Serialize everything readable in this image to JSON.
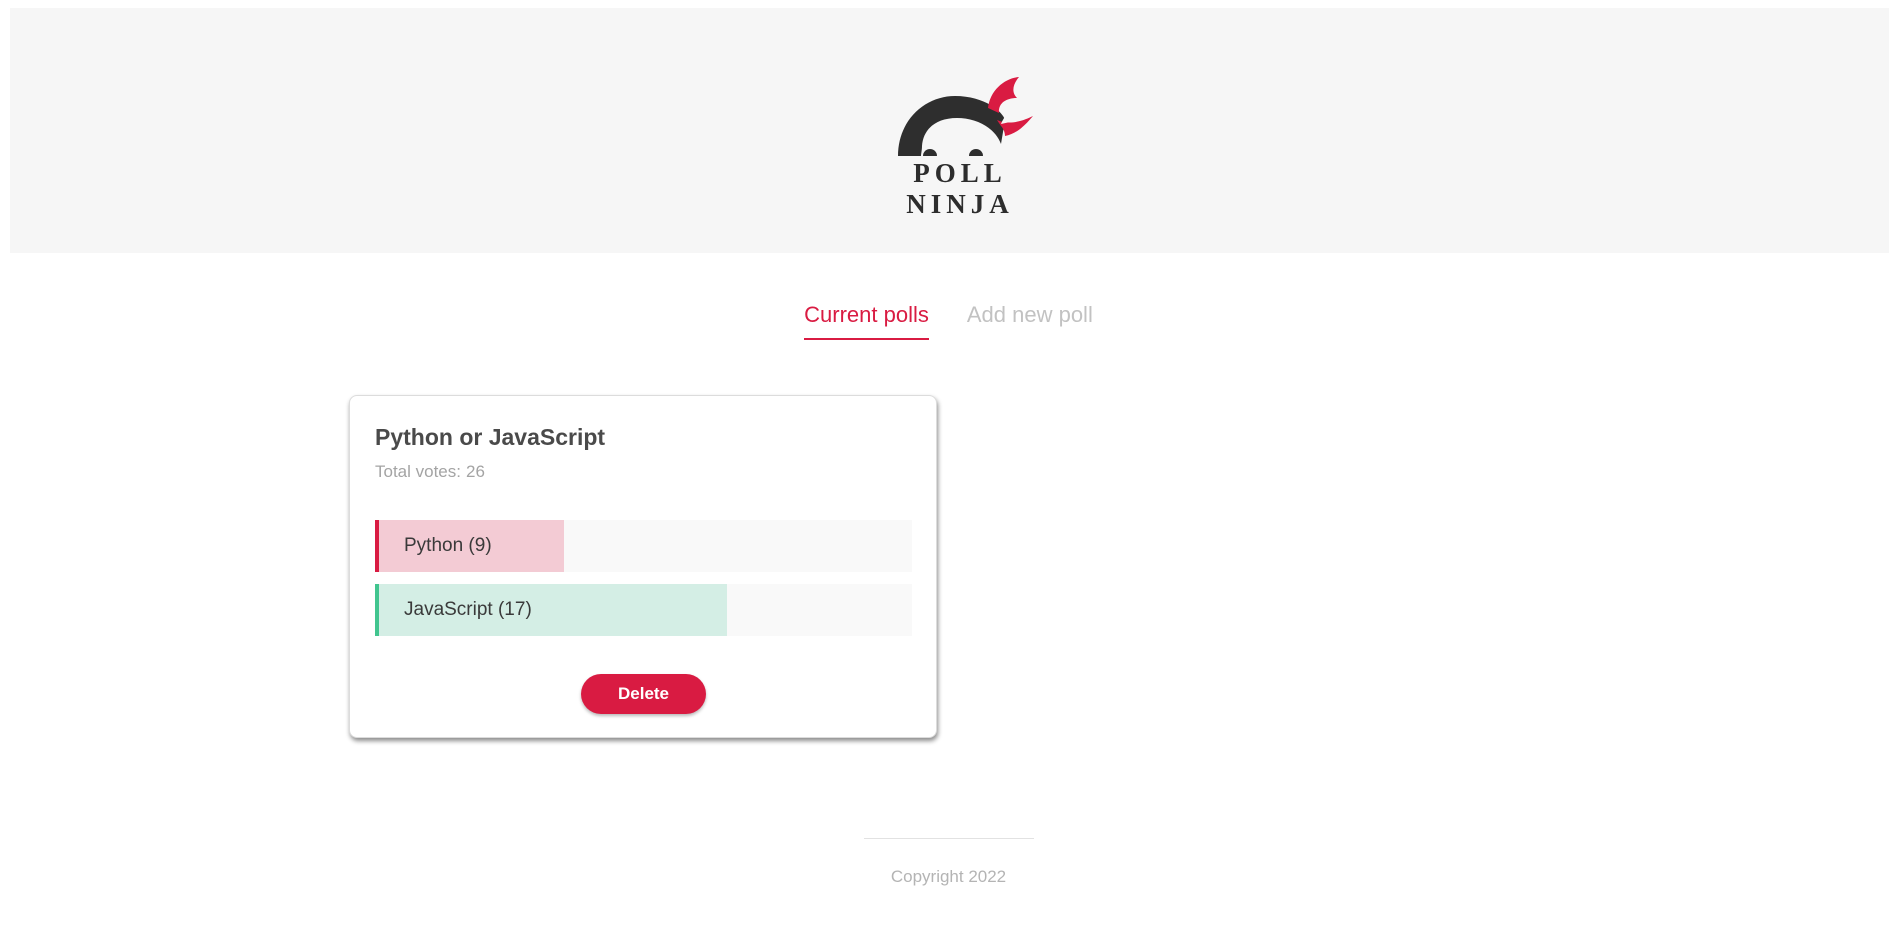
{
  "header": {
    "logo_text": "POLL NINJA"
  },
  "tabs": [
    {
      "label": "Current polls",
      "active": true
    },
    {
      "label": "Add new poll",
      "active": false
    }
  ],
  "polls": [
    {
      "question": "Python or JavaScript",
      "total_label": "Total votes:",
      "total_votes": 26,
      "options": [
        {
          "label": "Python (9)",
          "votes": 9,
          "color": "#d91b42",
          "fill": "#f3cbd4"
        },
        {
          "label": "JavaScript (17)",
          "votes": 17,
          "color": "#41c58f",
          "fill": "#d4eee5"
        }
      ],
      "delete_label": "Delete"
    }
  ],
  "footer": {
    "copyright": "Copyright 2022"
  },
  "colors": {
    "accent": "#d91b42",
    "header_bg": "#f6f6f6",
    "inactive_tab": "#c2c2c2"
  }
}
